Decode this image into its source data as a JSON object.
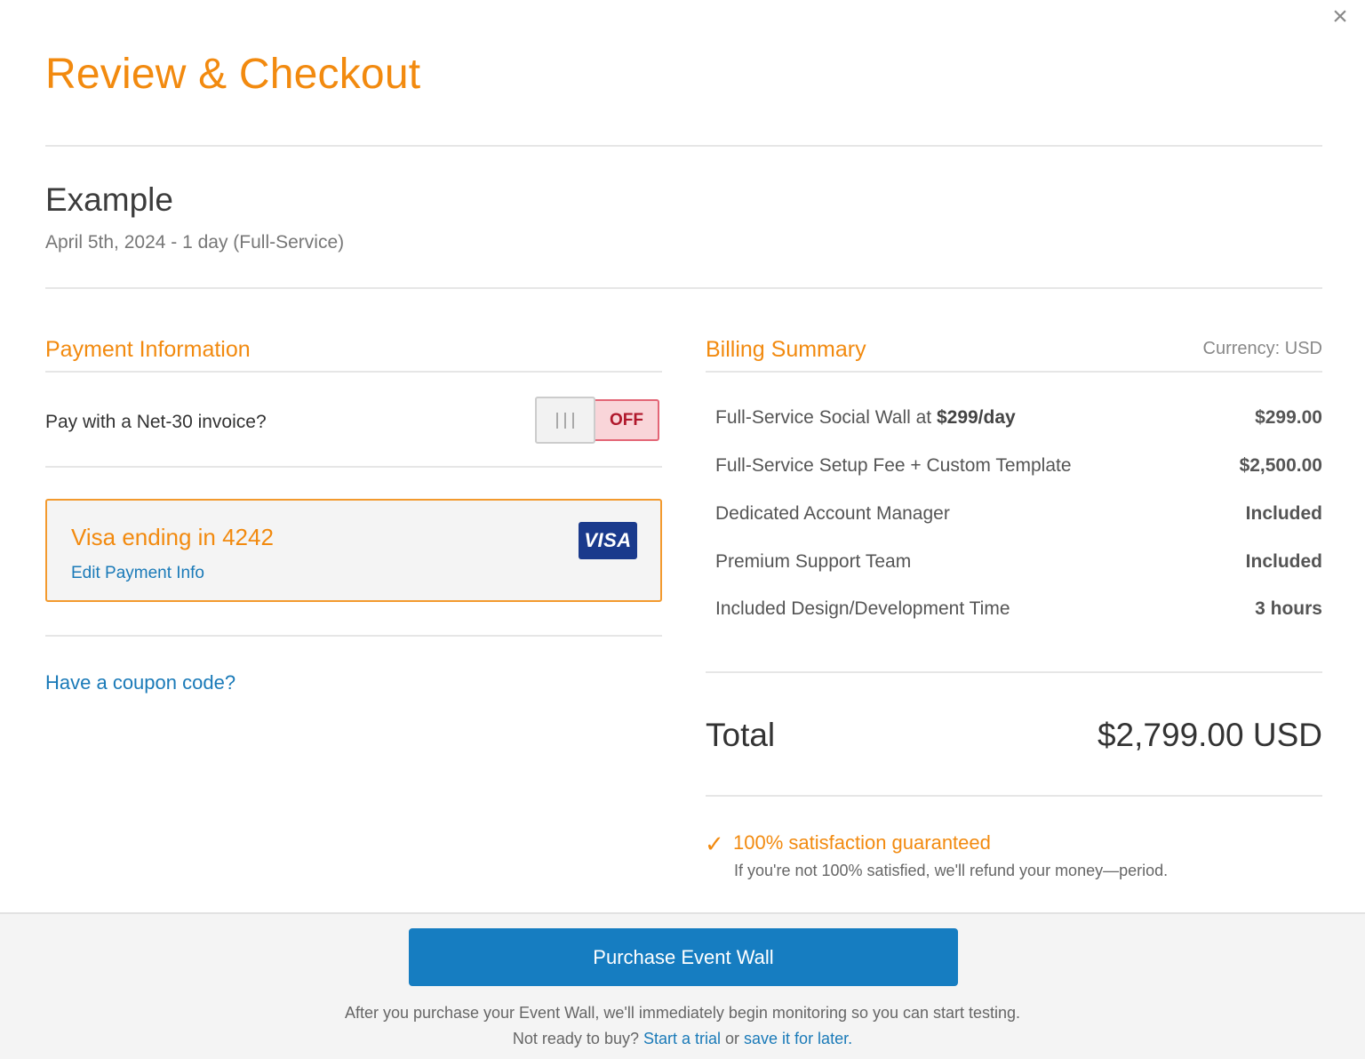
{
  "header": {
    "title": "Review & Checkout",
    "close_icon": "close-icon"
  },
  "event": {
    "name": "Example",
    "meta": "April 5th, 2024 - 1 day (Full-Service)"
  },
  "payment": {
    "section_title": "Payment Information",
    "invoice_question": "Pay with a Net-30 invoice?",
    "invoice_toggle": {
      "state": "OFF",
      "enabled": false
    },
    "card": {
      "label": "Visa ending in 4242",
      "edit_link": "Edit Payment Info",
      "brand": "VISA"
    },
    "coupon_link": "Have a coupon code?"
  },
  "billing": {
    "section_title": "Billing Summary",
    "currency": "Currency: USD",
    "items": [
      {
        "label": "Full-Service Social Wall at ",
        "label_bold": "$299/day",
        "amount": "$299.00"
      },
      {
        "label": "Full-Service Setup Fee + Custom Template",
        "label_bold": "",
        "amount": "$2,500.00"
      },
      {
        "label": "Dedicated Account Manager",
        "label_bold": "",
        "amount": "Included"
      },
      {
        "label": "Premium Support Team",
        "label_bold": "",
        "amount": "Included"
      },
      {
        "label": "Included Design/Development Time",
        "label_bold": "",
        "amount": "3 hours"
      }
    ],
    "total_label": "Total",
    "total_amount": "$2,799.00 USD"
  },
  "guarantee": {
    "icon": "checkmark-icon",
    "title": "100% satisfaction guaranteed",
    "text": "If you're not 100% satisfied, we'll refund your money—period."
  },
  "footer": {
    "purchase_button": "Purchase Event Wall",
    "note_part1": "After you purchase your Event Wall, we'll immediately begin monitoring so you can start testing. Not ready to buy? ",
    "trial_link": "Start a trial",
    "note_part2": " or ",
    "save_link": "save it for later."
  },
  "colors": {
    "accent": "#f28a0f",
    "link": "#1a7ab8",
    "primary_button": "#167dc1",
    "toggle_off_bg": "#f9d5d9",
    "toggle_off_text": "#b0182c"
  }
}
